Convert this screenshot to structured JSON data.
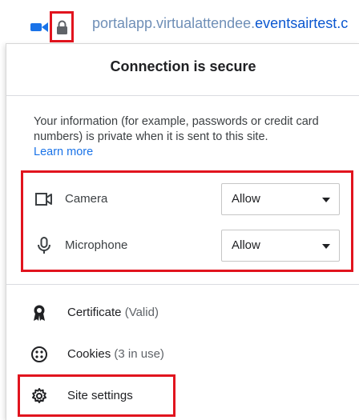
{
  "address_bar": {
    "url_prefix": "portalapp.virtualattendee.",
    "url_domain": "eventsairtest.c",
    "camera_icon": "video-camera-in-use-icon",
    "lock_icon": "lock-icon"
  },
  "popup": {
    "title": "Connection is secure",
    "info_text": "Your information (for example, passwords or credit card numbers) is private when it is sent to this site.",
    "learn_more": "Learn more",
    "permissions": [
      {
        "label": "Camera",
        "value": "Allow",
        "icon": "camera-icon"
      },
      {
        "label": "Microphone",
        "value": "Allow",
        "icon": "microphone-icon"
      }
    ],
    "items": [
      {
        "label": "Certificate",
        "sub": "(Valid)",
        "icon": "certificate-icon"
      },
      {
        "label": "Cookies",
        "sub": "(3 in use)",
        "icon": "cookie-icon"
      },
      {
        "label": "Site settings",
        "sub": "",
        "icon": "gear-icon"
      }
    ]
  },
  "colors": {
    "highlight": "#e1141e",
    "link": "#1a73e8"
  }
}
